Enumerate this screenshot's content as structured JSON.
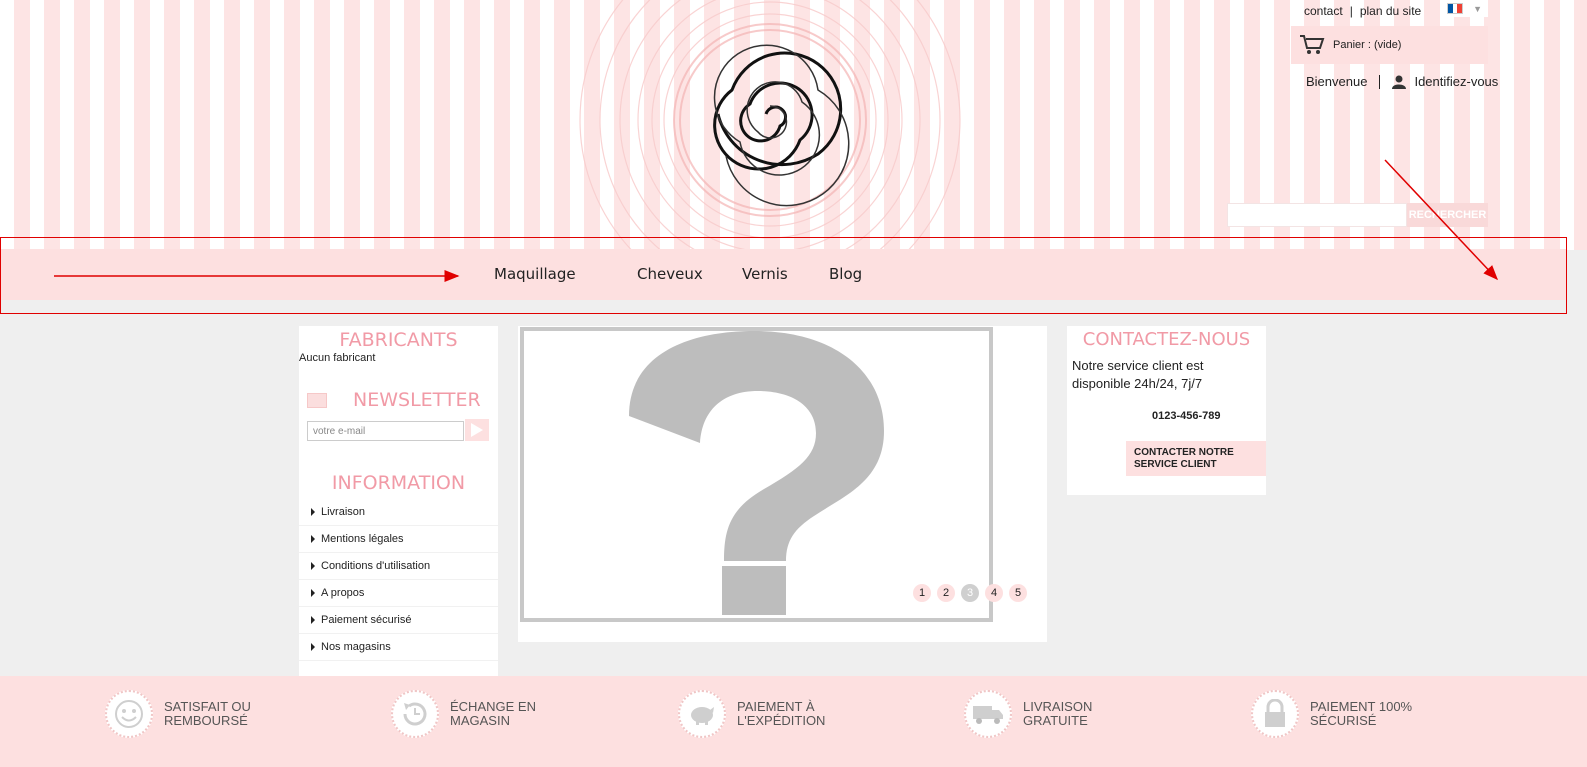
{
  "header": {
    "top_links": {
      "contact": "contact",
      "separator": "|",
      "sitemap": "plan du site"
    },
    "language": {
      "flag_colors": [
        "#0055a4",
        "#ffffff",
        "#ef4135"
      ],
      "icon": "chevron-down-icon"
    },
    "cart": {
      "label": "Panier : (vide)",
      "icon": "cart-icon"
    },
    "user": {
      "welcome": "Bienvenue",
      "login": "Identifiez-vous",
      "icon": "user-icon"
    },
    "search": {
      "button": "RECHERCHER",
      "value": ""
    }
  },
  "nav": {
    "items": [
      "Maquillage",
      "Cheveux",
      "Vernis",
      "Blog"
    ]
  },
  "left": {
    "manufacturers_title": "FABRICANTS",
    "manufacturers_empty": "Aucun fabricant",
    "newsletter_title": "NEWSLETTER",
    "newsletter_placeholder": "votre e-mail",
    "information_title": "INFORMATION",
    "information_items": [
      "Livraison",
      "Mentions légales",
      "Conditions d'utilisation",
      "A propos",
      "Paiement sécurisé",
      "Nos magasins"
    ]
  },
  "slider": {
    "pages": [
      "1",
      "2",
      "3",
      "4",
      "5"
    ],
    "active_page": "3"
  },
  "contact": {
    "title": "CONTACTEZ-NOUS",
    "text": "Notre service client est disponible 24h/24, 7j/7",
    "phone": "0123-456-789",
    "button": "CONTACTER NOTRE SERVICE CLIENT"
  },
  "footer": {
    "features": [
      {
        "line1": "SATISFAIT OU",
        "line2": "REMBOURSÉ",
        "icon": "smiley-icon"
      },
      {
        "line1": "ÉCHANGE EN",
        "line2": "MAGASIN",
        "icon": "exchange-clock-icon"
      },
      {
        "line1": "PAIEMENT À",
        "line2": "L'EXPÉDITION",
        "icon": "piggy-bank-icon"
      },
      {
        "line1": "LIVRAISON",
        "line2": "GRATUITE",
        "icon": "truck-icon"
      },
      {
        "line1": "PAIEMENT 100%",
        "line2": "SÉCURISÉ",
        "icon": "padlock-icon"
      }
    ]
  },
  "colors": {
    "accent_pink": "#f19aa6",
    "light_pink": "#fde0e0",
    "annotation_red": "#e00000"
  }
}
